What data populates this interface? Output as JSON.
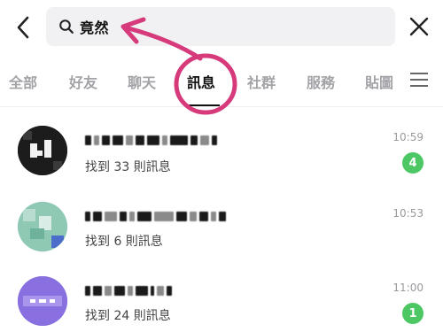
{
  "search": {
    "query": "竟然"
  },
  "tabs": [
    {
      "label": "全部"
    },
    {
      "label": "好友"
    },
    {
      "label": "聊天"
    },
    {
      "label": "訊息",
      "active": true
    },
    {
      "label": "社群"
    },
    {
      "label": "服務"
    },
    {
      "label": "貼圖"
    }
  ],
  "results": [
    {
      "summary": "找到 33 則訊息",
      "time": "10:59",
      "badge": "4"
    },
    {
      "summary": "找到 6 則訊息",
      "time": "10:53",
      "badge": ""
    },
    {
      "summary": "找到 24 則訊息",
      "time": "11:00",
      "badge": "1"
    }
  ],
  "colors": {
    "accent_green": "#4cc764",
    "annotation_pink": "#d63a7b",
    "search_bg": "#f1f1f3",
    "inactive_tab": "#a3a3a7"
  },
  "icons": {
    "back": "chevron-left-icon",
    "search": "search-icon",
    "close": "close-icon",
    "menu": "hamburger-menu-icon"
  }
}
